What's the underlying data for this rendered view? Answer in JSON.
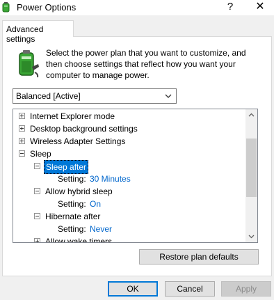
{
  "window": {
    "title": "Power Options",
    "help_glyph": "?",
    "close_glyph": "✕"
  },
  "tabs": [
    {
      "label": "Advanced settings"
    }
  ],
  "intro_text": "Select the power plan that you want to customize, and then choose settings that reflect how you want your computer to manage power.",
  "plan_select": {
    "value": "Balanced [Active]"
  },
  "tree": {
    "items": [
      {
        "label": "Internet Explorer mode"
      },
      {
        "label": "Desktop background settings"
      },
      {
        "label": "Wireless Adapter Settings"
      },
      {
        "label": "Sleep"
      },
      {
        "label": "Sleep after"
      },
      {
        "setting_label": "Setting:",
        "value": "30 Minutes"
      },
      {
        "label": "Allow hybrid sleep"
      },
      {
        "setting_label": "Setting:",
        "value": "On"
      },
      {
        "label": "Hibernate after"
      },
      {
        "setting_label": "Setting:",
        "value": "Never"
      },
      {
        "label": "Allow wake timers"
      }
    ]
  },
  "buttons": {
    "restore": "Restore plan defaults",
    "ok": "OK",
    "cancel": "Cancel",
    "apply": "Apply"
  },
  "colors": {
    "selection": "#0078d7",
    "setting_value": "#0066cc",
    "battery_green": "#3aa635"
  }
}
